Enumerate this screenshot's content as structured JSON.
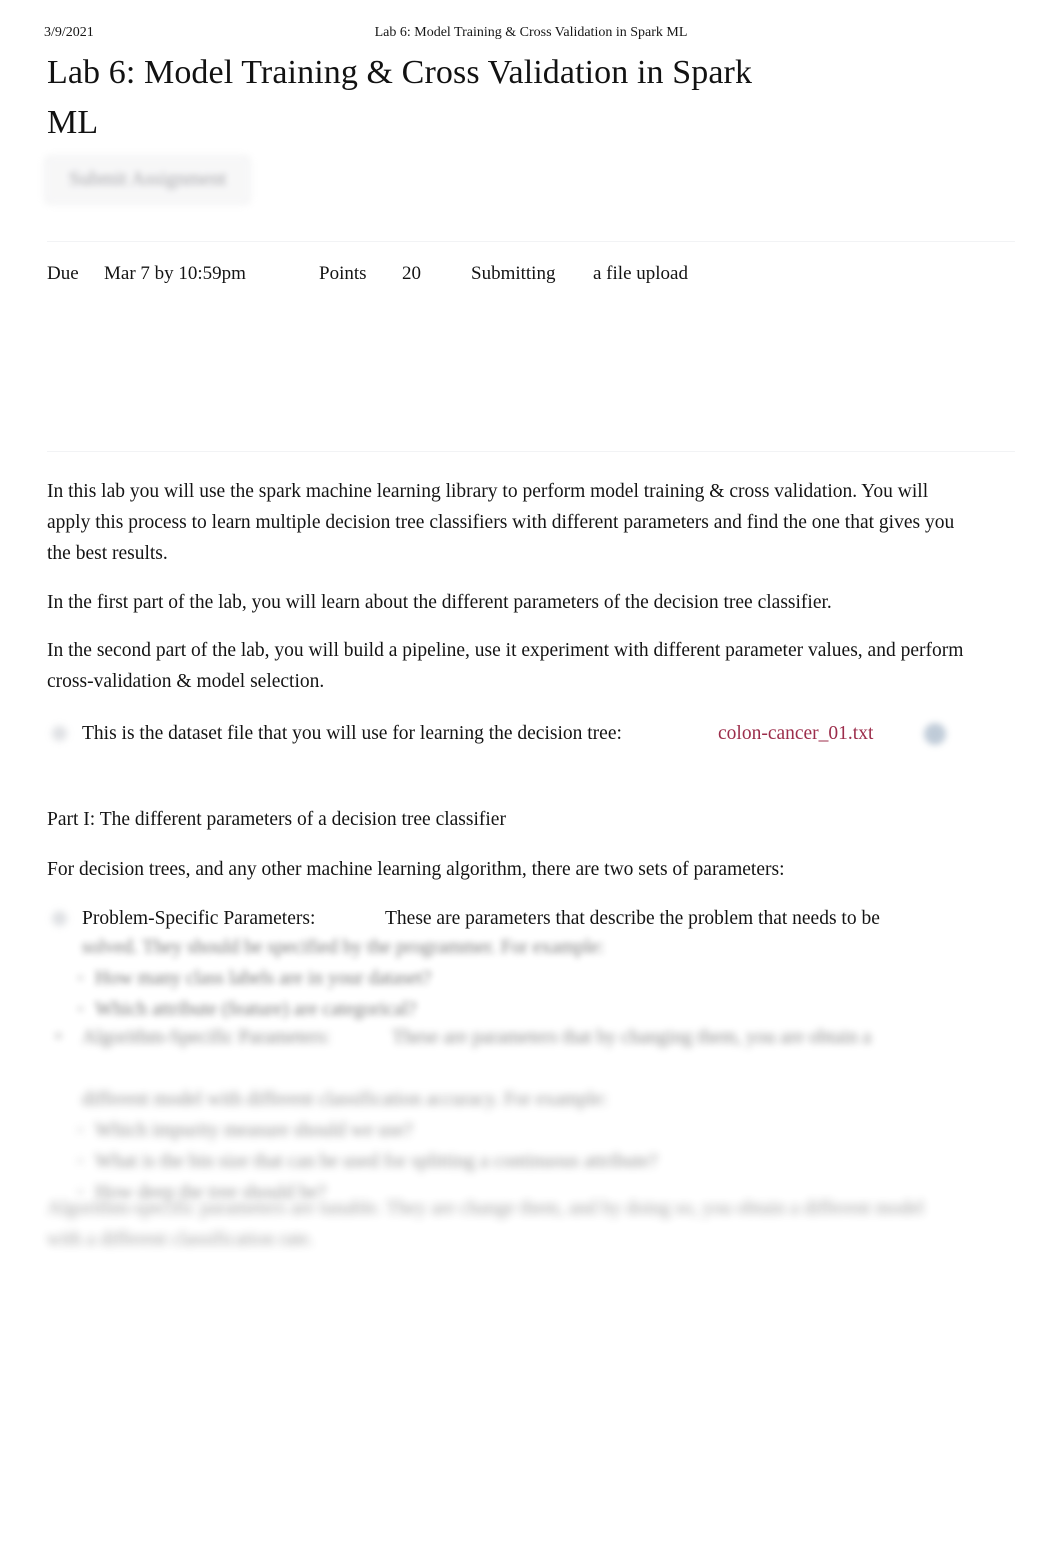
{
  "print_header": {
    "date": "3/9/2021",
    "document_title": "Lab 6: Model Training & Cross Validation in Spark ML"
  },
  "assignment": {
    "title": "Lab 6: Model Training & Cross Validation in Spark ML",
    "submit_button_label": "Submit Assignment"
  },
  "meta": {
    "due_label": "Due",
    "due_value": "Mar 7 by 10:59pm",
    "points_label": "Points",
    "points_value": "20",
    "submitting_label": "Submitting",
    "submitting_value": "a file upload"
  },
  "body": {
    "paragraph_1": "In this lab you will use the spark machine learning library to perform model training & cross validation. You will apply this process to learn multiple decision tree classifiers with different parameters and find the one that gives you the best results.",
    "paragraph_2": "In the first part of the lab, you will learn about the different parameters of the decision tree classifier.",
    "paragraph_3": "In the second part of the lab, you will build a pipeline, use it experiment with different parameter values, and perform cross-validation & model selection.",
    "dataset_line": "This is the dataset file that you will use for learning the decision tree:",
    "dataset_link_text": "colon-cancer_01.txt"
  },
  "part_one": {
    "heading": "Part I: The different parameters of a decision tree classifier",
    "intro": "For decision trees, and any other machine learning algorithm, there are two sets of parameters:",
    "items": [
      {
        "term": "Problem-Specific Parameters:",
        "definition": "These are parameters that describe the problem that needs to be",
        "continuation": "solved. They should be specified by the programmer. For example:",
        "sub_items": [
          "How many class labels are in your dataset?",
          "Which attribute (feature) are categorical?"
        ]
      },
      {
        "term": "Algorithm-Specific Parameters:",
        "definition": "These are parameters that by changing them, you are obtain a",
        "continuation": "different model with different classification accuracy. For example:",
        "sub_items": [
          "Which impurity measure should we use?",
          "What is the bin size that can be used for splitting a continuous attribute?",
          "How deep the tree should be?"
        ]
      }
    ],
    "closing": "Algorithm-specific parameters are     tunable.   They are change them, and by doing so, you obtain a different model with a different classification rate."
  },
  "colors": {
    "link": "#9c2d4b",
    "text": "#141414",
    "divider": "#f2f3f5",
    "button_text": "#9b9b9f",
    "button_bg": "#f6f6f7"
  },
  "icons": {
    "bullet": "bullet-dot-icon",
    "attachment": "attachment-icon"
  }
}
